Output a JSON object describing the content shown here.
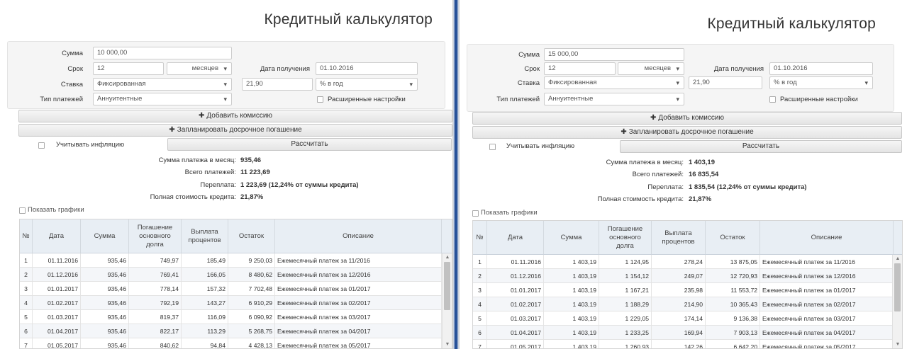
{
  "left": {
    "title": "Кредитный калькулятор",
    "labels": {
      "sum": "Сумма",
      "term": "Срок",
      "rate": "Ставка",
      "date": "Дата получения",
      "payment_type": "Тип платежей"
    },
    "values": {
      "sum": "10 000,00",
      "term": "12",
      "term_unit": "месяцев",
      "date": "01.10.2016",
      "rate_type": "Фиксированная",
      "rate": "21,90",
      "rate_unit": "% в год",
      "payment_type": "Аннуитентные"
    },
    "advanced_label": "Расширенные настройки",
    "add_commission": "Добавить комиссию",
    "plan_early": "Запланировать досрочное погашение",
    "inflation_label": "Учитывать инфляцию",
    "calculate": "Рассчитать",
    "results": {
      "monthly_label": "Сумма платежа в месяц:",
      "monthly_value": "935,46",
      "total_label": "Всего платежей:",
      "total_value": "11 223,69",
      "overpay_label": "Переплата:",
      "overpay_value": "1 223,69 (12,24% от суммы кредита)",
      "full_cost_label": "Полная стоимость кредита:",
      "full_cost_value": "21,87%"
    },
    "show_graphs": "Показать графики",
    "table": {
      "headers": [
        "№",
        "Дата",
        "Сумма",
        "Погашение основного долга",
        "Выплата процентов",
        "Остаток",
        "Описание"
      ],
      "rows": [
        [
          "1",
          "01.11.2016",
          "935,46",
          "749,97",
          "185,49",
          "9 250,03",
          "Ежемесячный платеж за 11/2016"
        ],
        [
          "2",
          "01.12.2016",
          "935,46",
          "769,41",
          "166,05",
          "8 480,62",
          "Ежемесячный платеж за 12/2016"
        ],
        [
          "3",
          "01.01.2017",
          "935,46",
          "778,14",
          "157,32",
          "7 702,48",
          "Ежемесячный платеж за 01/2017"
        ],
        [
          "4",
          "01.02.2017",
          "935,46",
          "792,19",
          "143,27",
          "6 910,29",
          "Ежемесячный платеж за 02/2017"
        ],
        [
          "5",
          "01.03.2017",
          "935,46",
          "819,37",
          "116,09",
          "6 090,92",
          "Ежемесячный платеж за 03/2017"
        ],
        [
          "6",
          "01.04.2017",
          "935,46",
          "822,17",
          "113,29",
          "5 268,75",
          "Ежемесячный платеж за 04/2017"
        ],
        [
          "7",
          "01.05.2017",
          "935,46",
          "840,62",
          "94,84",
          "4 428,13",
          "Ежемесячный платеж за 05/2017"
        ]
      ]
    }
  },
  "right": {
    "title": "Кредитный калькулятор",
    "labels": {
      "sum": "Сумма",
      "term": "Срок",
      "rate": "Ставка",
      "date": "Дата получения",
      "payment_type": "Тип платежей"
    },
    "values": {
      "sum": "15 000,00",
      "term": "12",
      "term_unit": "месяцев",
      "date": "01.10.2016",
      "rate_type": "Фиксированная",
      "rate": "21,90",
      "rate_unit": "% в год",
      "payment_type": "Аннуитентные"
    },
    "advanced_label": "Расширенные настройки",
    "add_commission": "Добавить комиссию",
    "plan_early": "Запланировать досрочное погашение",
    "inflation_label": "Учитывать инфляцию",
    "calculate": "Рассчитать",
    "results": {
      "monthly_label": "Сумма платежа в месяц:",
      "monthly_value": "1 403,19",
      "total_label": "Всего платежей:",
      "total_value": "16 835,54",
      "overpay_label": "Переплата:",
      "overpay_value": "1 835,54 (12,24% от суммы кредита)",
      "full_cost_label": "Полная стоимость кредита:",
      "full_cost_value": "21,87%"
    },
    "show_graphs": "Показать графики",
    "table": {
      "headers": [
        "№",
        "Дата",
        "Сумма",
        "Погашение основного долга",
        "Выплата процентов",
        "Остаток",
        "Описание"
      ],
      "rows": [
        [
          "1",
          "01.11.2016",
          "1 403,19",
          "1 124,95",
          "278,24",
          "13 875,05",
          "Ежемесячный платеж за 11/2016"
        ],
        [
          "2",
          "01.12.2016",
          "1 403,19",
          "1 154,12",
          "249,07",
          "12 720,93",
          "Ежемесячный платеж за 12/2016"
        ],
        [
          "3",
          "01.01.2017",
          "1 403,19",
          "1 167,21",
          "235,98",
          "11 553,72",
          "Ежемесячный платеж за 01/2017"
        ],
        [
          "4",
          "01.02.2017",
          "1 403,19",
          "1 188,29",
          "214,90",
          "10 365,43",
          "Ежемесячный платеж за 02/2017"
        ],
        [
          "5",
          "01.03.2017",
          "1 403,19",
          "1 229,05",
          "174,14",
          "9 136,38",
          "Ежемесячный платеж за 03/2017"
        ],
        [
          "6",
          "01.04.2017",
          "1 403,19",
          "1 233,25",
          "169,94",
          "7 903,13",
          "Ежемесячный платеж за 04/2017"
        ],
        [
          "7",
          "01.05.2017",
          "1 403,19",
          "1 260,93",
          "142,26",
          "6 642,20",
          "Ежемесячный платеж за 05/2017"
        ]
      ]
    }
  }
}
